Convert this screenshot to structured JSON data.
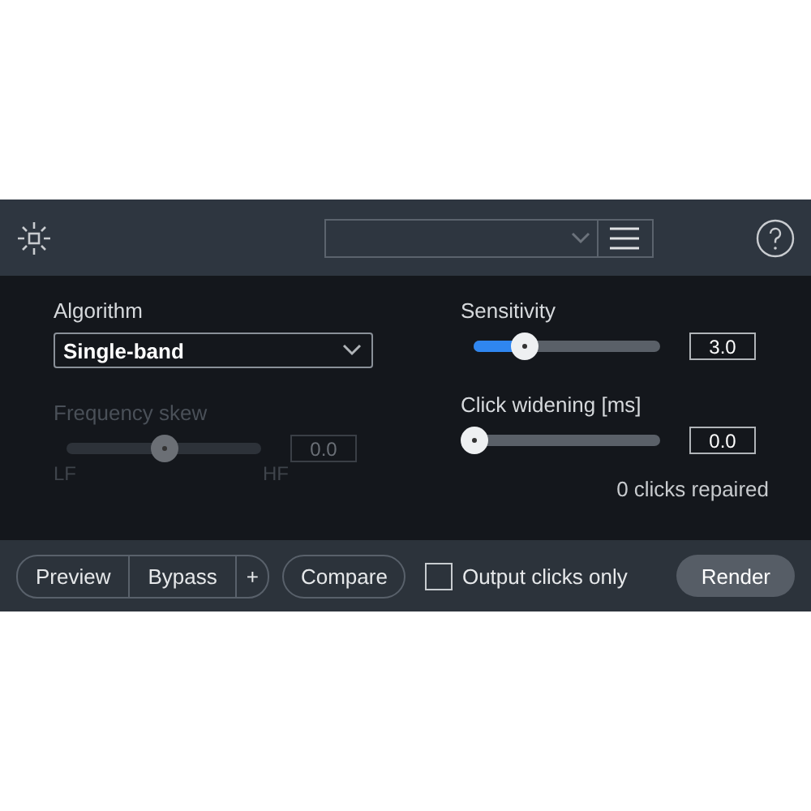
{
  "algorithm": {
    "label": "Algorithm",
    "value": "Single-band"
  },
  "sliders": [
    {
      "label": "Frequency skew",
      "level": 0.5,
      "value": "0.0",
      "disabled": true,
      "low_label": "LF",
      "high_label": "HF"
    },
    {
      "label": "Sensitivity",
      "level": 0.27,
      "value": "3.0",
      "disabled": false
    },
    {
      "label": "Click widening [ms]",
      "level": 0,
      "value": "0.0",
      "disabled": false
    }
  ],
  "status": "0 clicks repaired",
  "footer": {
    "segmented": [
      {
        "label": "Preview"
      },
      {
        "label": "Bypass"
      },
      {
        "label": "+"
      }
    ],
    "compare": "Compare",
    "checkbox": {
      "label": "Output clicks only",
      "checked": false
    },
    "render": "Render"
  }
}
